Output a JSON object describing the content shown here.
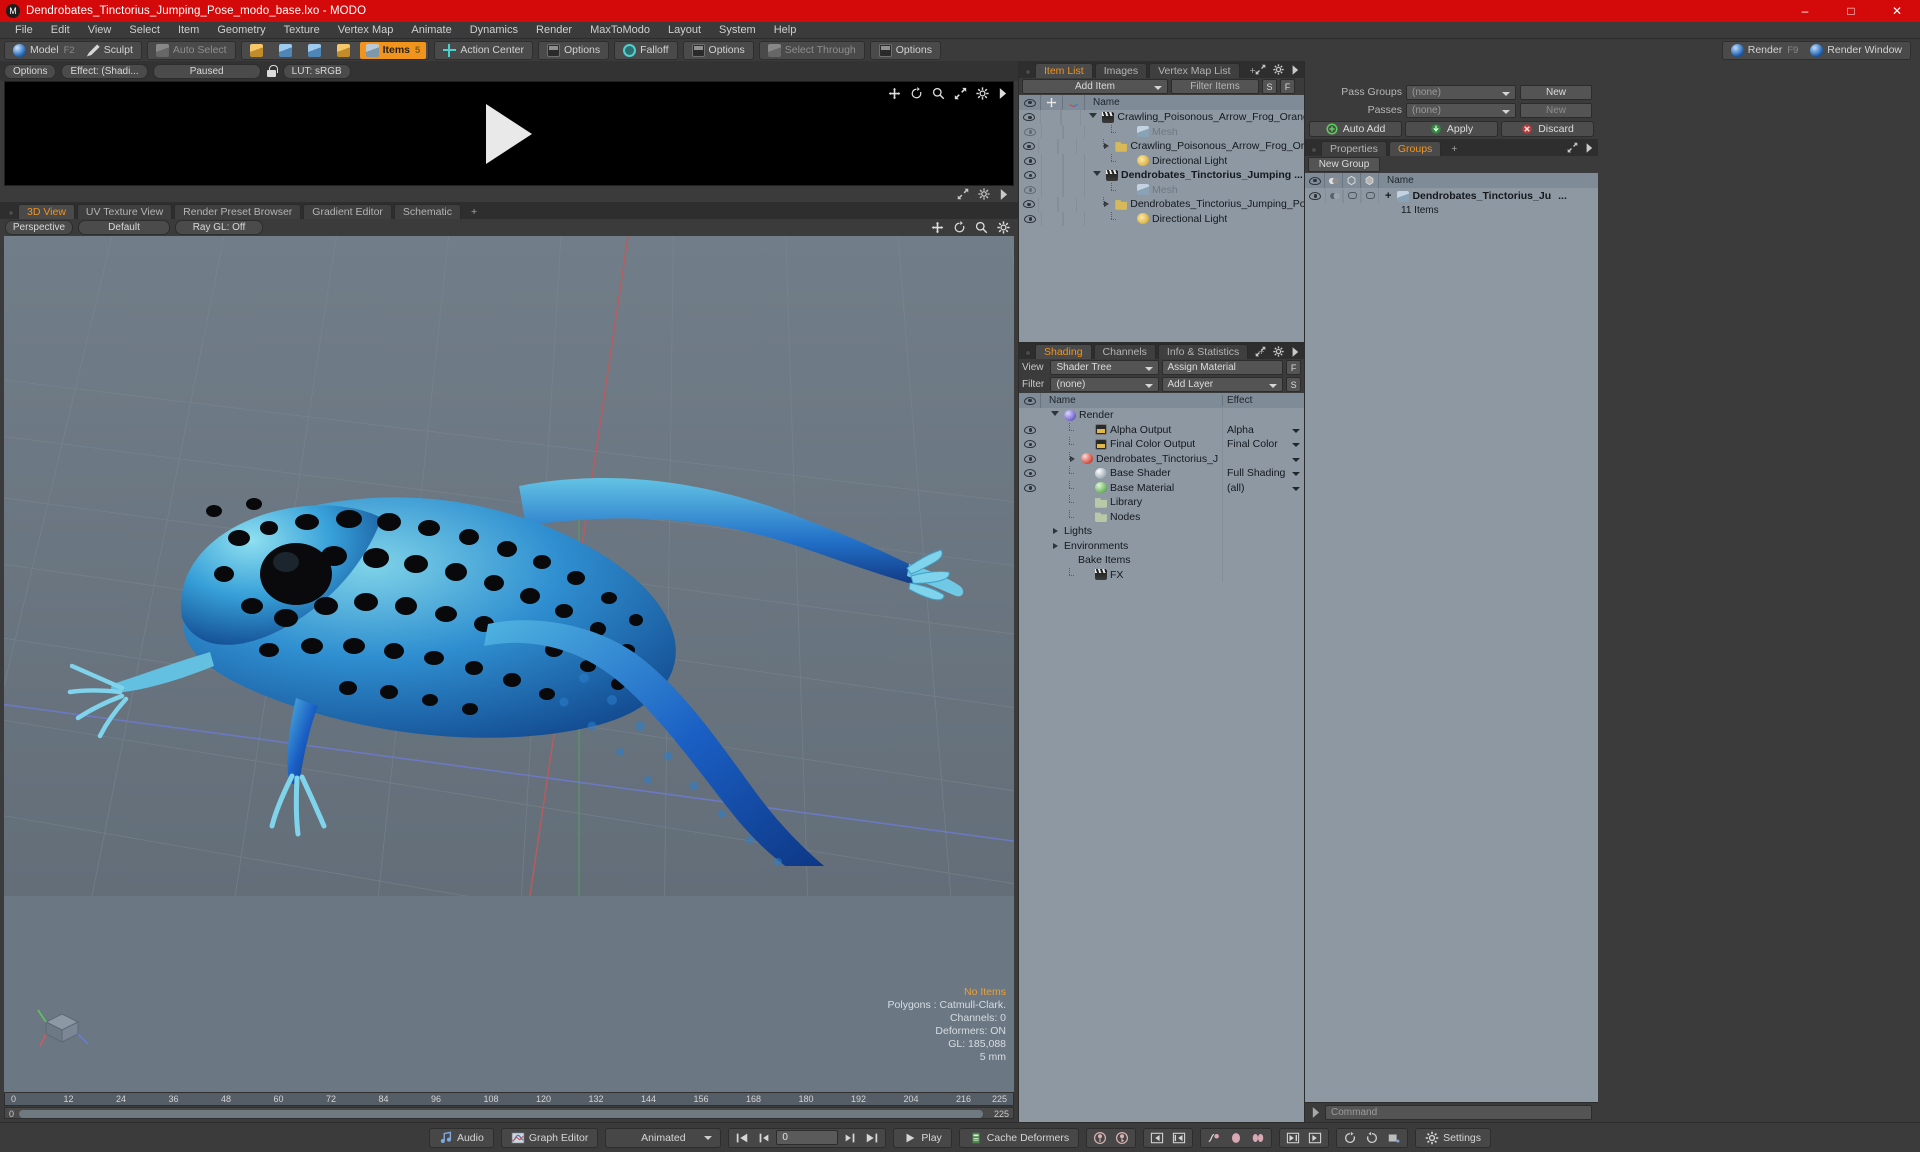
{
  "window": {
    "title": "Dendrobates_Tinctorius_Jumping_Pose_modo_base.lxo - MODO",
    "minimize": "–",
    "maximize": "□",
    "close": "✕",
    "accent_red": "#d40a0a",
    "accent_orange": "#f0941e"
  },
  "menu": {
    "items": [
      "File",
      "Edit",
      "View",
      "Select",
      "Item",
      "Geometry",
      "Texture",
      "Vertex Map",
      "Animate",
      "Dynamics",
      "Render",
      "MaxToModo",
      "Layout",
      "System",
      "Help"
    ]
  },
  "toolbar": {
    "mode": {
      "model": "Model",
      "model_key": "F2",
      "sculpt": "Sculpt"
    },
    "select": {
      "auto_select": "Auto Select",
      "items": "Items",
      "items_key": "5",
      "action_center": "Action Center",
      "options1": "Options",
      "falloff": "Falloff",
      "options2": "Options",
      "select_through": "Select Through",
      "options3": "Options"
    },
    "render": {
      "render": "Render",
      "render_key": "F9",
      "render_window": "Render Window"
    }
  },
  "preview": {
    "options": "Options",
    "effect": "Effect: (Shadi...",
    "paused": "Paused",
    "lut": "LUT: sRGB"
  },
  "viewport_tabs": {
    "tabs": [
      "3D View",
      "UV Texture View",
      "Render Preset Browser",
      "Gradient Editor",
      "Schematic"
    ],
    "active": "3D View",
    "add": "+"
  },
  "viewport_header": {
    "perspective": "Perspective",
    "shading_default": "Default",
    "ray_gl": "Ray GL: Off"
  },
  "viewport_stats": {
    "no_items": "No Items",
    "polygons": "Polygons : Catmull-Clark.",
    "channels": "Channels: 0",
    "deformers": "Deformers: ON",
    "gl": "GL: 185,088",
    "scale": "5 mm"
  },
  "timeline": {
    "ticks": [
      "0",
      "12",
      "24",
      "36",
      "48",
      "60",
      "72",
      "84",
      "96",
      "108",
      "120",
      "132",
      "144",
      "156",
      "168",
      "180",
      "192",
      "204",
      "216"
    ],
    "range_start": "0",
    "range_end": "225",
    "end_label": "225"
  },
  "item_list": {
    "tabs": [
      "Item List",
      "Images",
      "Vertex Map List"
    ],
    "active": "Item List",
    "add_tab": "+",
    "add_item": "Add Item",
    "filter_placeholder": "Filter Items",
    "btn_s": "S",
    "btn_f": "F",
    "column_name": "Name",
    "rows": [
      {
        "name": "Crawling_Poisonous_Arrow_Frog_Orang...",
        "icon": "clapper-icon",
        "indent": 0,
        "expand": "down",
        "dim": false,
        "bold": false,
        "eye": true
      },
      {
        "name": "Mesh",
        "icon": "mesh-icon",
        "indent": 1,
        "expand": "none",
        "dim": true,
        "bold": false,
        "eye": true
      },
      {
        "name": "Crawling_Poisonous_Arrow_Frog_Ora...",
        "icon": "folder-icon",
        "indent": 1,
        "expand": "right",
        "dim": false,
        "bold": false,
        "eye": true
      },
      {
        "name": "Directional Light",
        "icon": "light-icon",
        "indent": 1,
        "expand": "none",
        "dim": false,
        "bold": false,
        "eye": true
      },
      {
        "name": "Dendrobates_Tinctorius_Jumping ...",
        "icon": "clapper-icon",
        "indent": 0,
        "expand": "down",
        "dim": false,
        "bold": true,
        "eye": true
      },
      {
        "name": "Mesh",
        "icon": "mesh-icon",
        "indent": 1,
        "expand": "none",
        "dim": true,
        "bold": false,
        "eye": true
      },
      {
        "name": "Dendrobates_Tinctorius_Jumping_Pos...",
        "icon": "folder-icon",
        "indent": 1,
        "expand": "right",
        "dim": false,
        "bold": false,
        "eye": true
      },
      {
        "name": "Directional Light",
        "icon": "light-icon",
        "indent": 1,
        "expand": "none",
        "dim": false,
        "bold": false,
        "eye": true
      }
    ]
  },
  "shading": {
    "tabs": [
      "Shading",
      "Channels",
      "Info & Statistics"
    ],
    "active": "Shading",
    "add_tab": "+",
    "view_label": "View",
    "view_value": "Shader Tree",
    "assign_material": "Assign Material",
    "filter_label": "Filter",
    "filter_value": "(none)",
    "add_layer": "Add Layer",
    "btn_f": "F",
    "btn_s": "S",
    "col_name": "Name",
    "col_effect": "Effect",
    "rows": [
      {
        "name": "Render",
        "effect": "",
        "icon": "sphere-purple-icon",
        "indent": 0,
        "expand": "down",
        "eye": false,
        "dropdown": false
      },
      {
        "name": "Alpha Output",
        "effect": "Alpha",
        "icon": "image-icon",
        "indent": 1,
        "expand": "none",
        "eye": true,
        "dropdown": true
      },
      {
        "name": "Final Color Output",
        "effect": "Final Color",
        "icon": "image-icon",
        "indent": 1,
        "expand": "none",
        "eye": true,
        "dropdown": true
      },
      {
        "name": "Dendrobates_Tinctorius_J ...",
        "effect": "",
        "icon": "sphere-red-icon",
        "indent": 1,
        "expand": "right",
        "eye": true,
        "dropdown": true
      },
      {
        "name": "Base Shader",
        "effect": "Full Shading",
        "icon": "sphere-grey-icon",
        "indent": 1,
        "expand": "none",
        "eye": true,
        "dropdown": true
      },
      {
        "name": "Base Material",
        "effect": "(all)",
        "icon": "sphere-green-icon",
        "indent": 1,
        "expand": "none",
        "eye": true,
        "dropdown": true
      },
      {
        "name": "Library",
        "effect": "",
        "icon": "folder-green-icon",
        "indent": 1,
        "expand": "none",
        "eye": false,
        "dropdown": false
      },
      {
        "name": "Nodes",
        "effect": "",
        "icon": "folder-green-icon",
        "indent": 1,
        "expand": "none",
        "eye": false,
        "dropdown": false
      },
      {
        "name": "Lights",
        "effect": "",
        "icon": "none",
        "indent": 0,
        "expand": "right",
        "eye": false,
        "dropdown": false
      },
      {
        "name": "Environments",
        "effect": "",
        "icon": "none",
        "indent": 0,
        "expand": "right",
        "eye": false,
        "dropdown": false
      },
      {
        "name": "Bake Items",
        "effect": "",
        "icon": "none",
        "indent": 1,
        "expand": "none",
        "eye": false,
        "dropdown": false
      },
      {
        "name": "FX",
        "effect": "",
        "icon": "clapper-icon",
        "indent": 1,
        "expand": "none",
        "eye": false,
        "dropdown": false
      }
    ]
  },
  "passes": {
    "pass_groups_label": "Pass Groups",
    "pass_groups_value": "(none)",
    "pass_groups_new": "New",
    "passes_label": "Passes",
    "passes_value": "(none)",
    "passes_new": "New",
    "auto_add": "Auto Add",
    "apply": "Apply",
    "discard": "Discard"
  },
  "groups": {
    "tabs": [
      "Properties",
      "Groups"
    ],
    "active": "Groups",
    "add_tab": "+",
    "new_group": "New Group",
    "col_name": "Name",
    "rows": [
      {
        "name": "Dendrobates_Tinctorius_Ju",
        "overflow": "...",
        "sub": "11 Items",
        "expand": "+"
      }
    ]
  },
  "command": {
    "placeholder": "Command"
  },
  "bottom": {
    "audio": "Audio",
    "graph_editor": "Graph Editor",
    "animated": "Animated",
    "frame": "0",
    "play": "Play",
    "cache_deformers": "Cache Deformers",
    "settings": "Settings"
  }
}
